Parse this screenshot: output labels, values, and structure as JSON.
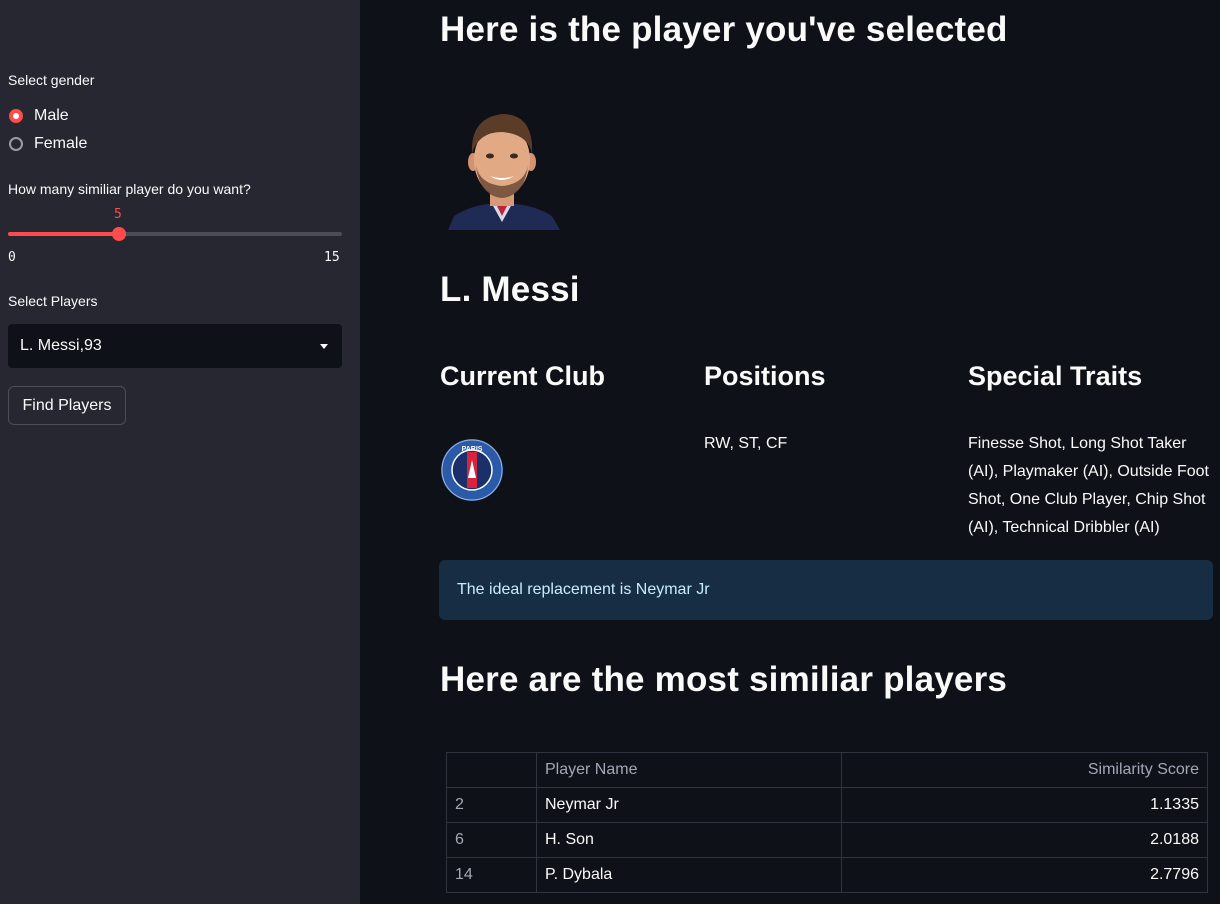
{
  "sidebar": {
    "gender_label": "Select gender",
    "gender_options": [
      "Male",
      "Female"
    ],
    "gender_selected": "Male",
    "slider_label": "How many similiar player do you want?",
    "slider_value": 5,
    "slider_min": 0,
    "slider_max": 15,
    "players_label": "Select Players",
    "players_selected": "L. Messi,93",
    "find_button": "Find Players"
  },
  "main": {
    "selected_heading": "Here is the player you've selected",
    "player_name": "L. Messi",
    "club_heading": "Current Club",
    "club_logo_text": "PARIS",
    "positions_heading": "Positions",
    "positions_value": "RW, ST, CF",
    "traits_heading": "Special Traits",
    "traits_value": "Finesse Shot, Long Shot Taker (AI), Playmaker (AI), Outside Foot Shot, One Club Player, Chip Shot (AI), Technical Dribbler (AI)",
    "replacement_text": "The ideal replacement is Neymar Jr",
    "similar_heading": "Here are the most similiar players",
    "table": {
      "columns": [
        "",
        "Player Name",
        "Similarity Score"
      ],
      "rows": [
        {
          "index": "2",
          "name": "Neymar Jr",
          "score": "1.1335"
        },
        {
          "index": "6",
          "name": "H. Son",
          "score": "2.0188"
        },
        {
          "index": "14",
          "name": "P. Dybala",
          "score": "2.7796"
        }
      ]
    }
  },
  "colors": {
    "accent": "#ff4b4b",
    "background": "#0e1117",
    "sidebar": "#262730",
    "info_bg": "#172d43"
  }
}
